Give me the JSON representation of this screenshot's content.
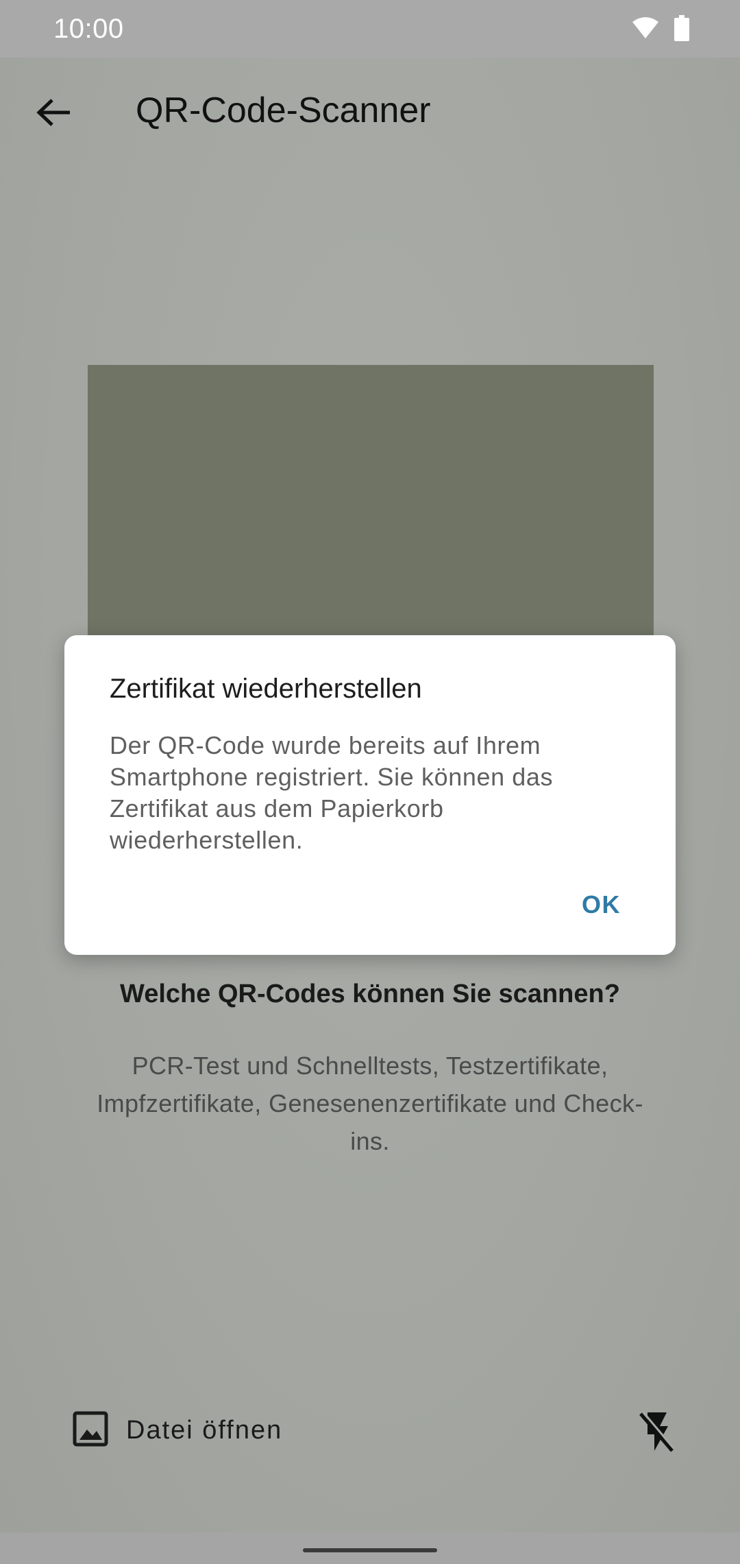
{
  "status_bar": {
    "time": "10:00",
    "icons": [
      "wifi-icon",
      "battery-icon"
    ]
  },
  "app_bar": {
    "title": "QR-Code-Scanner",
    "back_icon": "back-arrow-icon"
  },
  "info": {
    "heading": "Welche QR-Codes können Sie scannen?",
    "body": "PCR-Test und Schnelltests, Testzertifikate, Impfzertifikate, Genesenenzertifikate und Check-ins."
  },
  "bottom_actions": {
    "open_file_label": "Datei öffnen",
    "open_file_icon": "image-icon",
    "flash_icon": "flash-off-icon"
  },
  "dialog": {
    "title": "Zertifikat wiederherstellen",
    "message": "Der QR-Code wurde bereits auf Ihrem Smartphone registriert. Sie können das Zertifikat aus dem Papierkorb wiederherstellen.",
    "ok_label": "OK"
  },
  "colors": {
    "accent": "#2f7aa6",
    "scrim_background": "#a7aaa5",
    "scan_window": "#6f7465",
    "dialog_background": "#ffffff"
  }
}
